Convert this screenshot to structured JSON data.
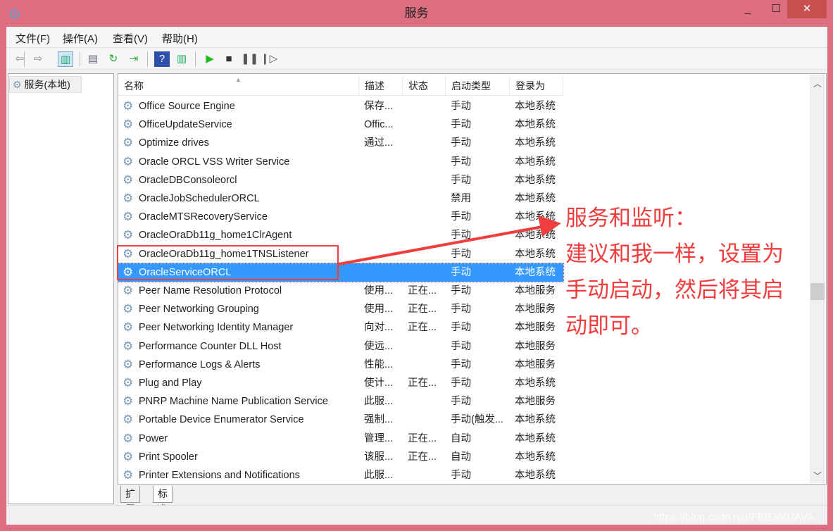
{
  "window": {
    "title": "服务",
    "icon": "services-gear-icon",
    "minimize": "_",
    "maximize": "☐",
    "close": "✕"
  },
  "menu": [
    "文件(F)",
    "操作(A)",
    "查看(V)",
    "帮助(H)"
  ],
  "toolbar": [
    {
      "icon": "back-arrow-icon",
      "g": "⇦"
    },
    {
      "icon": "forward-arrow-icon",
      "g": "⇨"
    },
    {
      "icon": "show-hide-console-tree-icon",
      "g": "▥"
    },
    {
      "icon": "properties-icon",
      "g": "▤"
    },
    {
      "icon": "refresh-icon",
      "g": "↻"
    },
    {
      "icon": "export-list-icon",
      "g": "⇥"
    },
    {
      "icon": "help-icon",
      "g": "?"
    },
    {
      "icon": "action-pane-icon",
      "g": "▥"
    },
    {
      "icon": "start-icon",
      "g": "▶"
    },
    {
      "icon": "stop-icon",
      "g": "■"
    },
    {
      "icon": "pause-icon",
      "g": "❚❚"
    },
    {
      "icon": "resume-icon",
      "g": "❙▷"
    }
  ],
  "tree": {
    "label": "服务(本地)"
  },
  "columns": [
    "名称",
    "描述",
    "状态",
    "启动类型",
    "登录为"
  ],
  "sort_indicator": "▲",
  "rows": [
    [
      "Office Source Engine",
      "保存...",
      "",
      "手动",
      "本地系统"
    ],
    [
      "OfficeUpdateService",
      "Offic...",
      "",
      "手动",
      "本地系统"
    ],
    [
      "Optimize drives",
      "通过...",
      "",
      "手动",
      "本地系统"
    ],
    [
      "Oracle ORCL VSS Writer Service",
      "",
      "",
      "手动",
      "本地系统"
    ],
    [
      "OracleDBConsoleorcl",
      "",
      "",
      "手动",
      "本地系统"
    ],
    [
      "OracleJobSchedulerORCL",
      "",
      "",
      "禁用",
      "本地系统"
    ],
    [
      "OracleMTSRecoveryService",
      "",
      "",
      "手动",
      "本地系统"
    ],
    [
      "OracleOraDb11g_home1ClrAgent",
      "",
      "",
      "手动",
      "本地系统"
    ],
    [
      "OracleOraDb11g_home1TNSListener",
      "",
      "",
      "手动",
      "本地系统"
    ],
    [
      "OracleServiceORCL",
      "",
      "",
      "手动",
      "本地系统"
    ],
    [
      "Peer Name Resolution Protocol",
      "使用...",
      "正在...",
      "手动",
      "本地服务"
    ],
    [
      "Peer Networking Grouping",
      "使用...",
      "正在...",
      "手动",
      "本地服务"
    ],
    [
      "Peer Networking Identity Manager",
      "向对...",
      "正在...",
      "手动",
      "本地服务"
    ],
    [
      "Performance Counter DLL Host",
      "使远...",
      "",
      "手动",
      "本地服务"
    ],
    [
      "Performance Logs & Alerts",
      "性能...",
      "",
      "手动",
      "本地服务"
    ],
    [
      "Plug and Play",
      "使计...",
      "正在...",
      "手动",
      "本地系统"
    ],
    [
      "PNRP Machine Name Publication Service",
      "此服...",
      "",
      "手动",
      "本地服务"
    ],
    [
      "Portable Device Enumerator Service",
      "强制...",
      "",
      "手动(触发...",
      "本地系统"
    ],
    [
      "Power",
      "管理...",
      "正在...",
      "自动",
      "本地系统"
    ],
    [
      "Print Spooler",
      "该服...",
      "正在...",
      "自动",
      "本地系统"
    ],
    [
      "Printer Extensions and Notifications",
      "此服...",
      "",
      "手动",
      "本地系统"
    ]
  ],
  "selected_row": 9,
  "tabs": [
    "扩展",
    "标准"
  ],
  "active_tab": 1,
  "annotation": {
    "color": "#f03e3e",
    "lines": [
      "服务和监听：",
      "建议和我一样，设置为",
      "手动启动，然后将其启",
      "动即可。"
    ]
  },
  "watermark": "https://blog.csdn.net/FBB360JAVA",
  "colors": {
    "frame": "#dc6e80",
    "selection": "#3399ff",
    "close": "#c7504f"
  }
}
